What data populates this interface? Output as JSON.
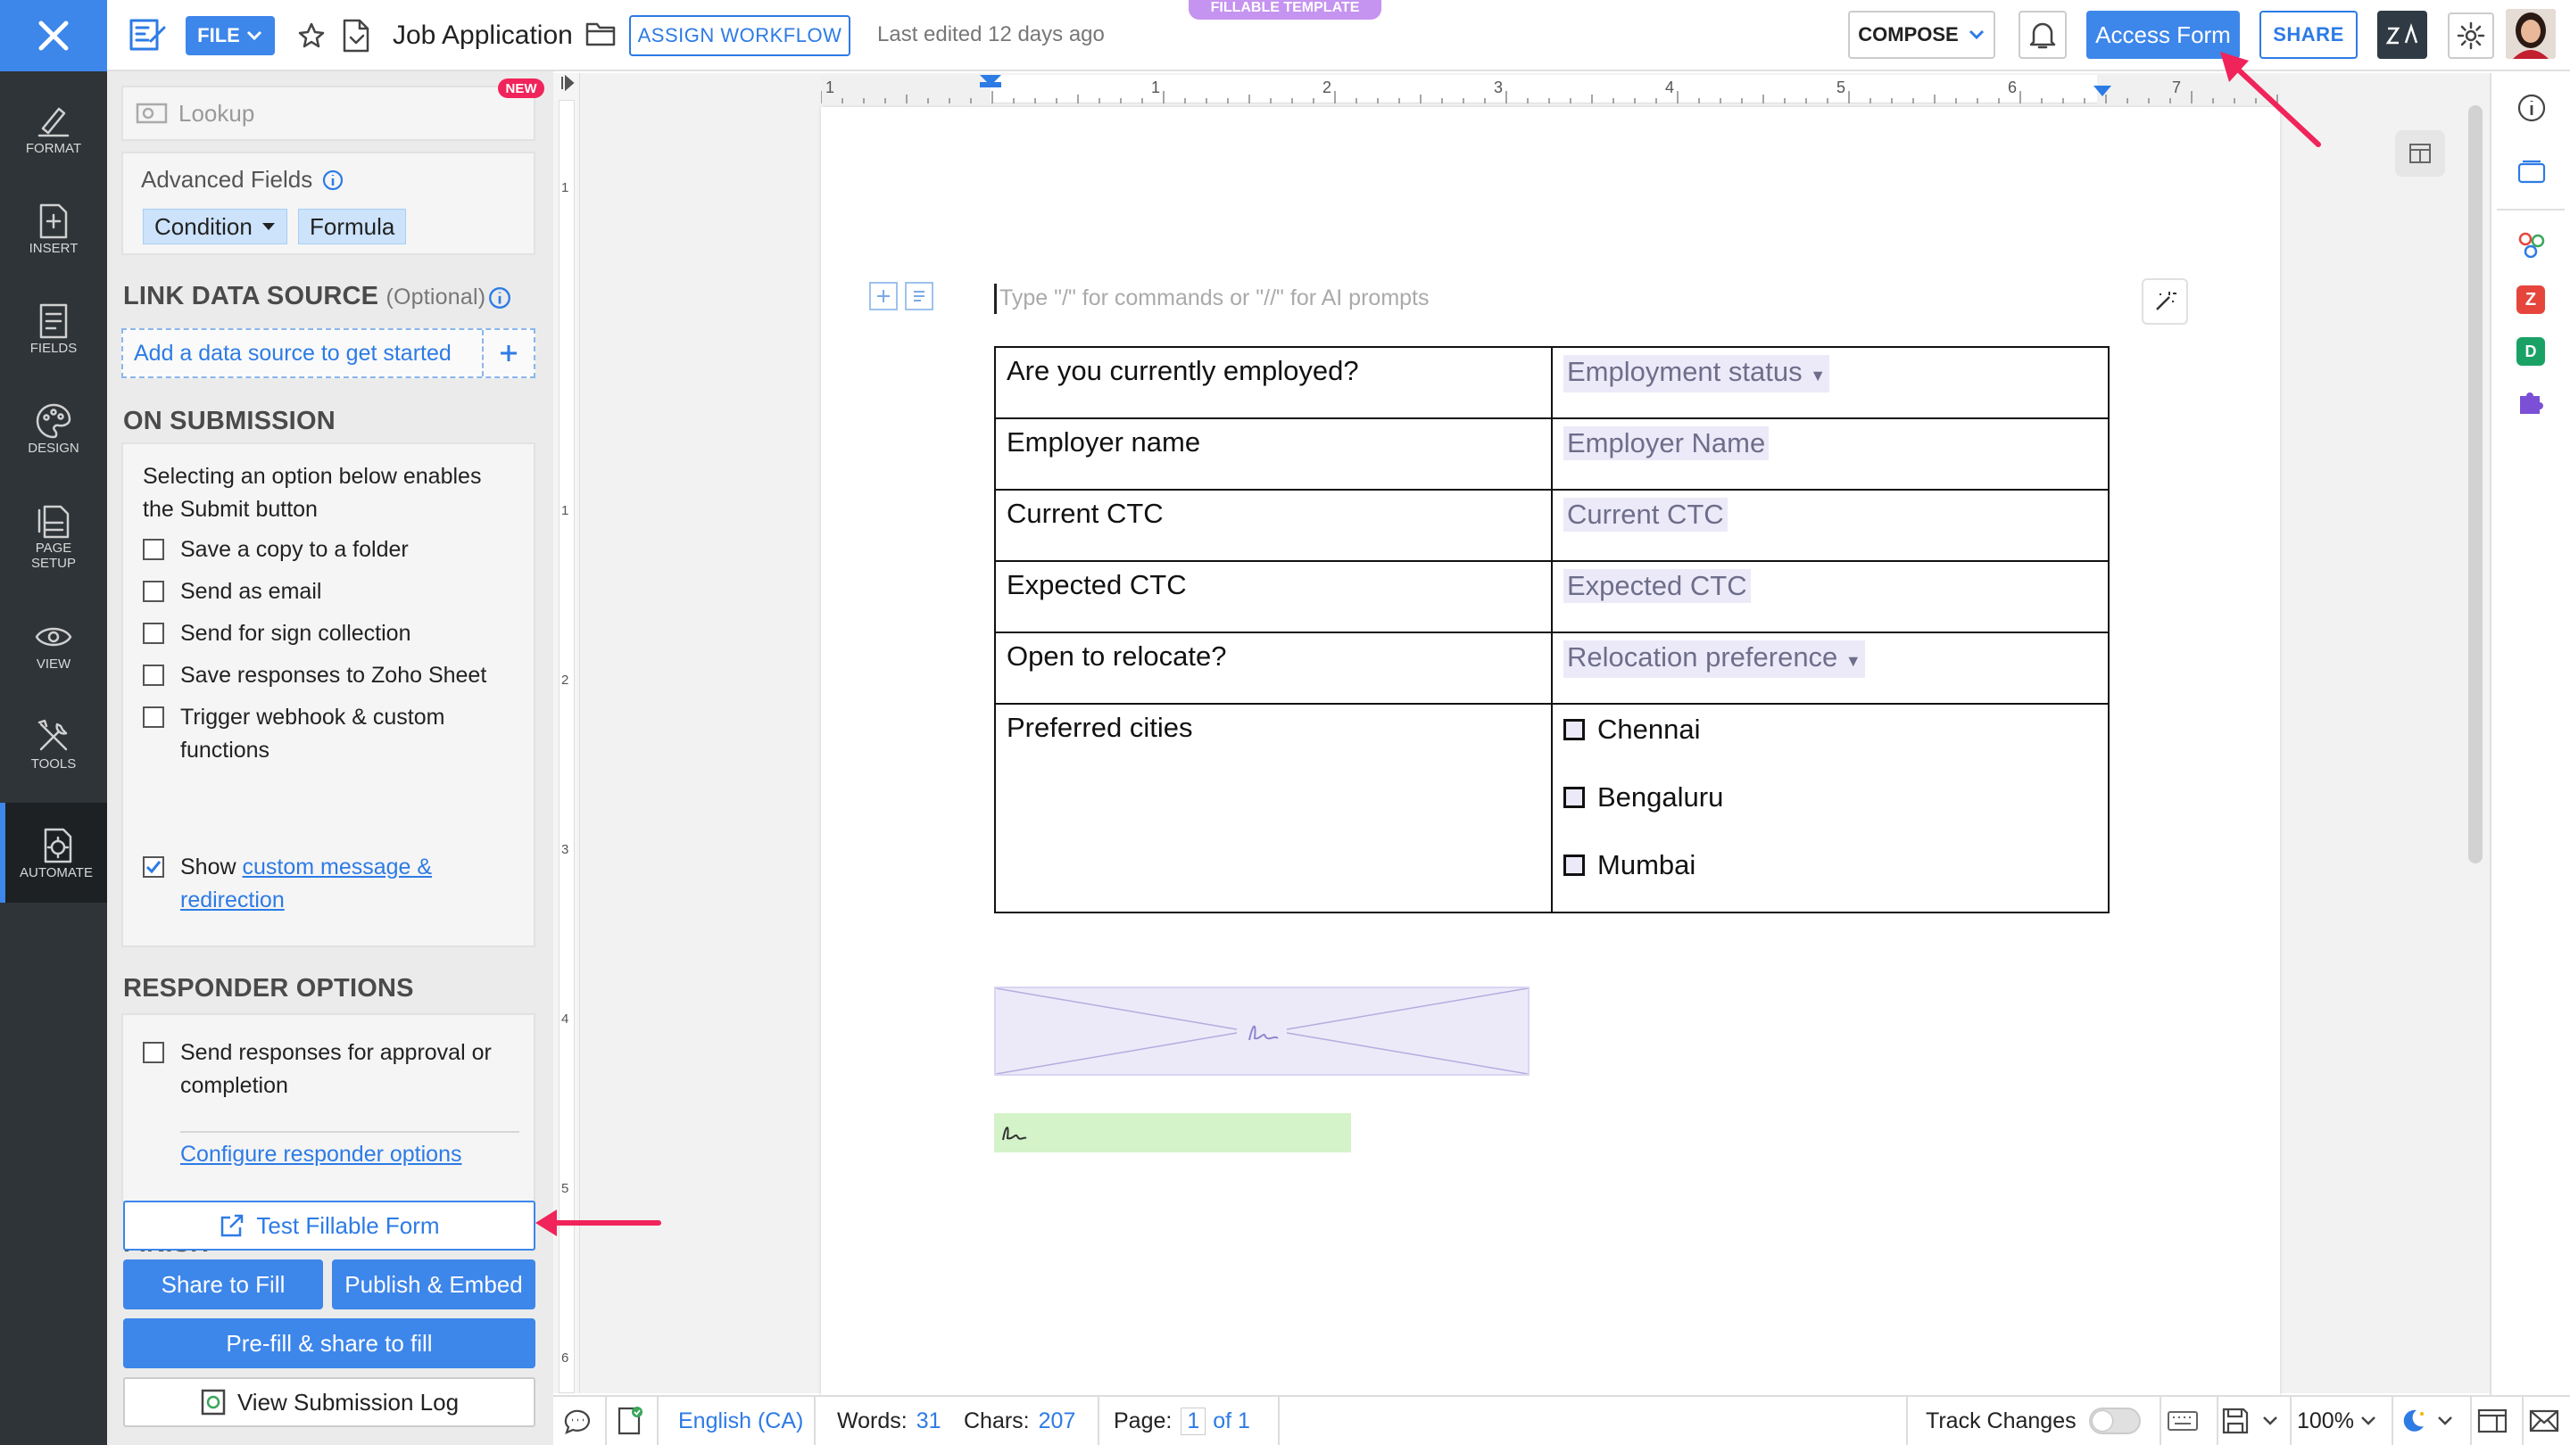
{
  "header": {
    "file_label": "FILE",
    "doc_title": "Job Application",
    "assign_workflow": "ASSIGN WORKFLOW",
    "last_edited": "Last edited 12 days ago",
    "template_badge": "FILLABLE TEMPLATE",
    "compose_label": "COMPOSE",
    "access_form_label": "Access Form",
    "share_label": "SHARE"
  },
  "rail": [
    {
      "label": "FORMAT",
      "icon": "format-icon"
    },
    {
      "label": "INSERT",
      "icon": "insert-icon"
    },
    {
      "label": "FIELDS",
      "icon": "fields-icon"
    },
    {
      "label": "DESIGN",
      "icon": "design-icon"
    },
    {
      "label": "PAGE SETUP",
      "icon": "page-setup-icon"
    },
    {
      "label": "VIEW",
      "icon": "view-icon"
    },
    {
      "label": "TOOLS",
      "icon": "tools-icon"
    },
    {
      "label": "AUTOMATE",
      "icon": "automate-icon"
    }
  ],
  "panel": {
    "lookup_label": "Lookup",
    "new_badge": "NEW",
    "advanced_fields_label": "Advanced Fields",
    "condition_label": "Condition",
    "formula_label": "Formula",
    "link_title": "LINK DATA SOURCE",
    "link_optional": "(Optional)",
    "add_data_source": "Add a data source to get started",
    "on_submission_title": "ON SUBMISSION",
    "submission_desc": "Selecting an option below enables the Submit button",
    "options": [
      {
        "label": "Save a copy to a folder",
        "checked": false
      },
      {
        "label": "Send as email",
        "checked": false
      },
      {
        "label": "Send for sign collection",
        "checked": false
      },
      {
        "label": "Save responses to Zoho Sheet",
        "checked": false
      },
      {
        "label": "Trigger webhook & custom functions",
        "checked": false
      }
    ],
    "show_prefix": "Show",
    "show_link": "custom message & redirection",
    "responder_title": "RESPONDER OPTIONS",
    "responder_option": "Send responses for approval or completion",
    "configure_responder": "Configure responder options",
    "finish_title": "FINISH",
    "test_form": "Test Fillable Form",
    "share_to_fill": "Share to Fill",
    "publish_embed": "Publish & Embed",
    "prefill_share": "Pre-fill & share to fill",
    "view_log": "View Submission Log"
  },
  "ruler": {
    "h_numbers": [
      "1",
      "1",
      "2",
      "3",
      "4",
      "5",
      "6",
      "7"
    ],
    "v_numbers": [
      "1",
      "1",
      "2",
      "3",
      "4",
      "5",
      "6"
    ]
  },
  "doc": {
    "prompt_placeholder": "Type \"/\" for commands or \"//\" for AI prompts",
    "rows": [
      {
        "question": "Are you currently employed?",
        "field": "Employment status",
        "dropdown": true
      },
      {
        "question": "Employer name",
        "field": "Employer Name",
        "dropdown": false
      },
      {
        "question": "Current CTC",
        "field": "Current CTC",
        "dropdown": false
      },
      {
        "question": "Expected CTC",
        "field": "Expected CTC",
        "dropdown": false
      },
      {
        "question": "Open to relocate?",
        "field": "Relocation preference",
        "dropdown": true
      }
    ],
    "cities_question": "Preferred cities",
    "cities": [
      "Chennai",
      "Bengaluru",
      "Mumbai"
    ]
  },
  "status": {
    "language": "English (CA)",
    "words_label": "Words:",
    "words": "31",
    "chars_label": "Chars:",
    "chars": "207",
    "page_label": "Page:",
    "page": "1",
    "page_of": "of 1",
    "track_changes": "Track Changes",
    "zoom": "100%"
  },
  "colors": {
    "accent": "#3d86ea",
    "field_bg": "#eceaf9",
    "signature_bg": "#d4f3c8",
    "annotation_arrow": "#f0245a"
  }
}
